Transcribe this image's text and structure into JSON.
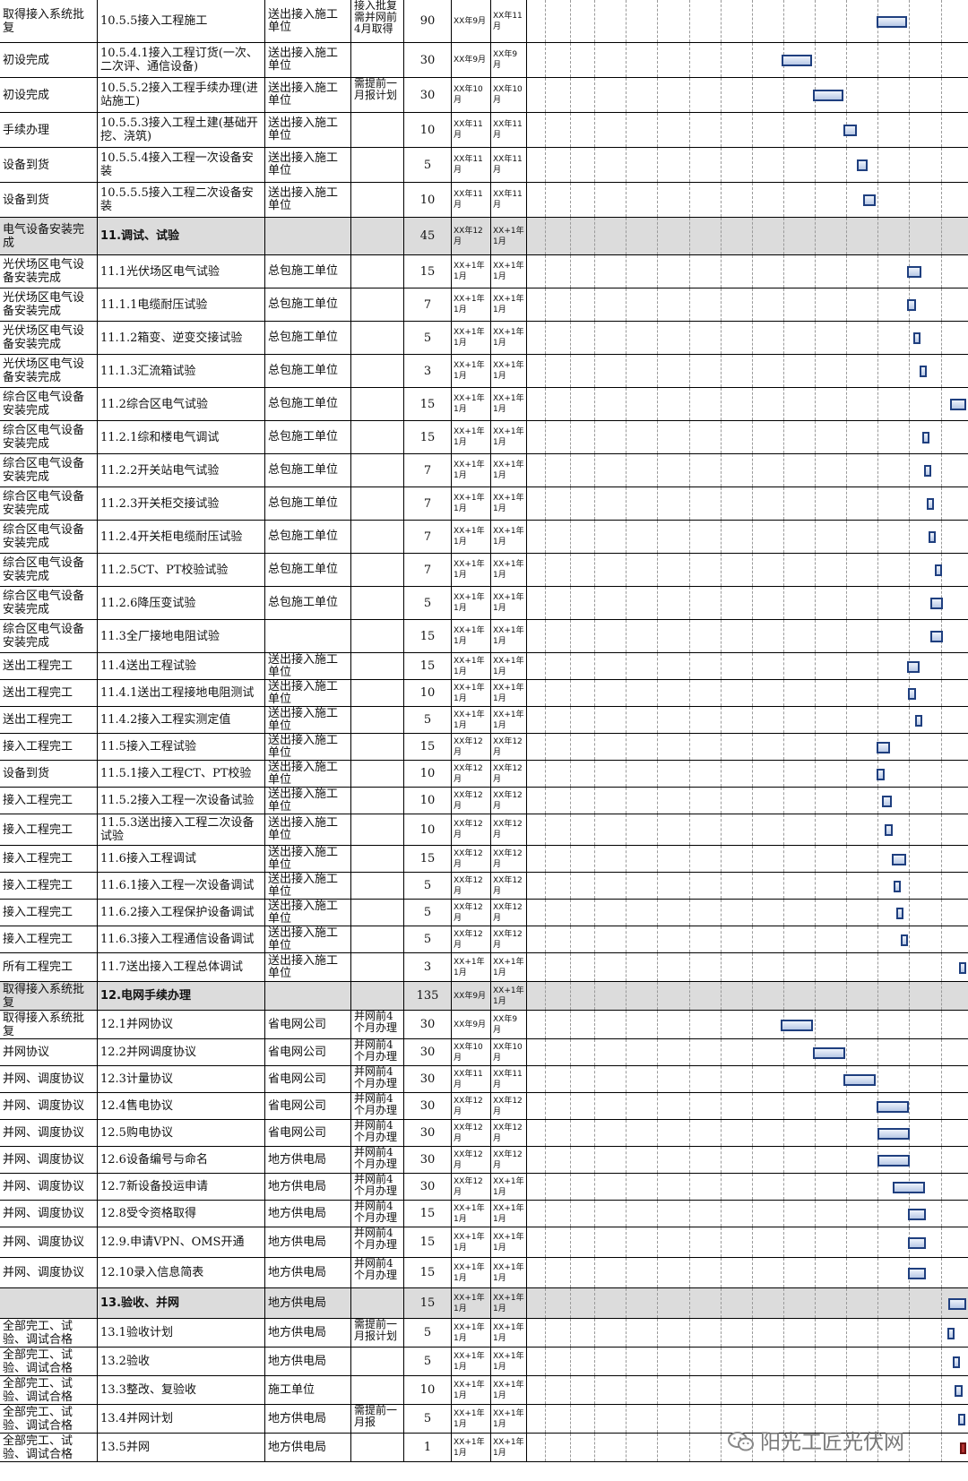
{
  "rows": [
    {
      "pre": "取得接入系统批复",
      "task": "10.5.5接入工程施工",
      "unit": "送出接入施工单位",
      "note": "接入批复需并网前4月取得",
      "dur": "90",
      "start": "XX年9月",
      "end": "XX年11月",
      "bar": {
        "s": 0.795,
        "w": 0.07
      }
    },
    {
      "pre": "初设完成",
      "task": "10.5.4.1接入工程订货(一次、二次评、通信设备)",
      "unit": "送出接入施工单位",
      "note": "",
      "dur": "30",
      "start": "XX年9月",
      "end": "XX年9月",
      "bar": {
        "s": 0.58,
        "w": 0.07
      }
    },
    {
      "pre": "初设完成",
      "task": "10.5.5.2接入工程手续办理(进站施工)",
      "unit": "送出接入施工单位",
      "note": "需提前一月报计划",
      "dur": "30",
      "start": "XX年10月",
      "end": "XX年10月",
      "bar": {
        "s": 0.65,
        "w": 0.07
      }
    },
    {
      "pre": "手续办理",
      "task": "10.5.5.3接入工程土建(基础开挖、浇筑)",
      "unit": "送出接入施工单位",
      "note": "",
      "dur": "10",
      "start": "XX年11月",
      "end": "XX年11月",
      "bar": {
        "s": 0.72,
        "w": 0.03
      }
    },
    {
      "pre": "设备到货",
      "task": "10.5.5.4接入工程一次设备安装",
      "unit": "送出接入施工单位",
      "note": "",
      "dur": "5",
      "start": "XX年11月",
      "end": "XX年11月",
      "bar": {
        "s": 0.75,
        "w": 0.024
      }
    },
    {
      "pre": "设备到货",
      "task": "10.5.5.5接入工程二次设备安装",
      "unit": "送出接入施工单位",
      "note": "",
      "dur": "10",
      "start": "XX年11月",
      "end": "XX年11月",
      "bar": {
        "s": 0.765,
        "w": 0.028
      }
    },
    {
      "hdr": true,
      "pre": "电气设备安装完成",
      "task": "11.调试、试验",
      "unit": "",
      "note": "",
      "dur": "45",
      "start": "XX年12月",
      "end": "XX+1年1月",
      "bar": null
    },
    {
      "pre": "光伏场区电气设备安装完成",
      "task": "11.1光伏场区电气试验",
      "unit": "总包施工单位",
      "note": "",
      "dur": "15",
      "start": "XX+1年1月",
      "end": "XX+1年1月",
      "bar": {
        "s": 0.866,
        "w": 0.032
      }
    },
    {
      "pre": "光伏场区电气设备安装完成",
      "task": "11.1.1电缆耐压试验",
      "unit": "总包施工单位",
      "note": "",
      "dur": "7",
      "start": "XX+1年1月",
      "end": "XX+1年1月",
      "bar": {
        "s": 0.866,
        "w": 0.02
      }
    },
    {
      "pre": "光伏场区电气设备安装完成",
      "task": "11.1.2箱变、逆变交接试验",
      "unit": "总包施工单位",
      "note": "",
      "dur": "5",
      "start": "XX+1年1月",
      "end": "XX+1年1月",
      "bar": {
        "s": 0.88,
        "w": 0.013
      }
    },
    {
      "pre": "光伏场区电气设备安装完成",
      "task": "11.1.3汇流箱试验",
      "unit": "总包施工单位",
      "note": "",
      "dur": "3",
      "start": "XX+1年1月",
      "end": "XX+1年1月",
      "bar": {
        "s": 0.893,
        "w": 0.012
      }
    },
    {
      "pre": "综合区电气设备安装完成",
      "task": "11.2综合区电气试验",
      "unit": "总包施工单位",
      "note": "",
      "dur": "15",
      "start": "XX+1年1月",
      "end": "XX+1年1月",
      "bar": {
        "s": 0.963,
        "w": 0.037
      }
    },
    {
      "pre": "综合区电气设备安装完成",
      "task": "11.2.1综和楼电气调试",
      "unit": "总包施工单位",
      "note": "",
      "dur": "15",
      "start": "XX+1年1月",
      "end": "XX+1年1月",
      "bar": {
        "s": 0.9,
        "w": 0.013
      }
    },
    {
      "pre": "综合区电气设备安装完成",
      "task": "11.2.2开关站电气试验",
      "unit": "总包施工单位",
      "note": "",
      "dur": "7",
      "start": "XX+1年1月",
      "end": "XX+1年1月",
      "bar": {
        "s": 0.904,
        "w": 0.013
      }
    },
    {
      "pre": "综合区电气设备安装完成",
      "task": "11.2.3开关柜交接试验",
      "unit": "总包施工单位",
      "note": "",
      "dur": "7",
      "start": "XX+1年1月",
      "end": "XX+1年1月",
      "bar": {
        "s": 0.91,
        "w": 0.012
      }
    },
    {
      "pre": "综合区电气设备安装完成",
      "task": "11.2.4开关柜电缆耐压试验",
      "unit": "总包施工单位",
      "note": "",
      "dur": "7",
      "start": "XX+1年1月",
      "end": "XX+1年1月",
      "bar": {
        "s": 0.915,
        "w": 0.012
      }
    },
    {
      "pre": "综合区电气设备安装完成",
      "task": "11.2.5CT、PT校验试验",
      "unit": "总包施工单位",
      "note": "",
      "dur": "7",
      "start": "XX+1年1月",
      "end": "XX+1年1月",
      "bar": {
        "s": 0.928,
        "w": 0.012
      }
    },
    {
      "pre": "综合区电气设备安装完成",
      "task": "11.2.6降压变试验",
      "unit": "总包施工单位",
      "note": "",
      "dur": "5",
      "start": "XX+1年1月",
      "end": "XX+1年1月",
      "bar": {
        "s": 0.918,
        "w": 0.028
      }
    },
    {
      "pre": "综合区电气设备安装完成",
      "task": "11.3全厂接地电阻试验",
      "unit": "",
      "note": "",
      "dur": "15",
      "start": "XX+1年1月",
      "end": "XX+1年1月",
      "bar": {
        "s": 0.918,
        "w": 0.028
      }
    },
    {
      "pre": "送出工程完工",
      "task": "11.4送出工程试验",
      "unit": "送出接入施工单位",
      "note": "",
      "dur": "15",
      "start": "XX+1年1月",
      "end": "XX+1年1月",
      "bar": {
        "s": 0.866,
        "w": 0.028
      }
    },
    {
      "pre": "送出工程完工",
      "task": "11.4.1送出工程接地电阻测试",
      "unit": "送出接入施工单位",
      "note": "",
      "dur": "10",
      "start": "XX+1年1月",
      "end": "XX+1年1月",
      "bar": {
        "s": 0.868,
        "w": 0.019
      }
    },
    {
      "pre": "送出工程完工",
      "task": "11.4.2接入工程实测定值",
      "unit": "送出接入施工单位",
      "note": "",
      "dur": "5",
      "start": "XX+1年1月",
      "end": "XX+1年1月",
      "bar": {
        "s": 0.883,
        "w": 0.012
      }
    },
    {
      "pre": "接入工程完工",
      "task": "11.5接入工程试验",
      "unit": "送出接入施工单位",
      "note": "",
      "dur": "15",
      "start": "XX年12月",
      "end": "XX年12月",
      "bar": {
        "s": 0.795,
        "w": 0.03
      }
    },
    {
      "pre": "设备到货",
      "task": "11.5.1接入工程CT、PT校验",
      "unit": "送出接入施工单位",
      "note": "",
      "dur": "10",
      "start": "XX年12月",
      "end": "XX年12月",
      "bar": {
        "s": 0.795,
        "w": 0.018
      }
    },
    {
      "pre": "接入工程完工",
      "task": "11.5.2接入工程一次设备试验",
      "unit": "送出接入施工单位",
      "note": "",
      "dur": "10",
      "start": "XX年12月",
      "end": "XX年12月",
      "bar": {
        "s": 0.808,
        "w": 0.022
      }
    },
    {
      "pre": "接入工程完工",
      "task": "11.5.3送出接入工程二次设备试验",
      "unit": "送出接入施工单位",
      "note": "",
      "dur": "10",
      "start": "XX年12月",
      "end": "XX年12月",
      "bar": {
        "s": 0.815,
        "w": 0.019
      }
    },
    {
      "pre": "接入工程完工",
      "task": "11.6接入工程调试",
      "unit": "送出接入施工单位",
      "note": "",
      "dur": "15",
      "start": "XX年12月",
      "end": "XX年12月",
      "bar": {
        "s": 0.83,
        "w": 0.032
      }
    },
    {
      "pre": "接入工程完工",
      "task": "11.6.1接入工程一次设备调试",
      "unit": "送出接入施工单位",
      "note": "",
      "dur": "5",
      "start": "XX年12月",
      "end": "XX年12月",
      "bar": {
        "s": 0.834,
        "w": 0.015
      }
    },
    {
      "pre": "接入工程完工",
      "task": "11.6.2接入工程保护设备调试",
      "unit": "送出接入施工单位",
      "note": "",
      "dur": "5",
      "start": "XX年12月",
      "end": "XX年12月",
      "bar": {
        "s": 0.84,
        "w": 0.015
      }
    },
    {
      "pre": "接入工程完工",
      "task": "11.6.3接入工程通信设备调试",
      "unit": "送出接入施工单位",
      "note": "",
      "dur": "5",
      "start": "XX年12月",
      "end": "XX年12月",
      "bar": {
        "s": 0.85,
        "w": 0.011
      }
    },
    {
      "pre": "所有工程完工",
      "task": "11.7送出接入工程总体调试",
      "unit": "送出接入施工单位",
      "note": "",
      "dur": "3",
      "start": "XX+1年1月",
      "end": "XX+1年1月",
      "bar": {
        "s": 0.984,
        "w": 0.014
      }
    },
    {
      "hdr": true,
      "pre": "取得接入系统批复",
      "task": "12.电网手续办理",
      "unit": "",
      "note": "",
      "dur": "135",
      "start": "XX年9月",
      "end": "XX+1年1月",
      "bar": null
    },
    {
      "pre": "取得接入系统批复",
      "task": "12.1并网协议",
      "unit": "省电网公司",
      "note": "并网前4个月办理",
      "dur": "30",
      "start": "XX年9月",
      "end": "XX年9月",
      "bar": {
        "s": 0.578,
        "w": 0.074
      }
    },
    {
      "pre": "并网协议",
      "task": "12.2并网调度协议",
      "unit": "省电网公司",
      "note": "并网前4个月办理",
      "dur": "30",
      "start": "XX年10月",
      "end": "XX年10月",
      "bar": {
        "s": 0.65,
        "w": 0.074
      }
    },
    {
      "pre": "并网、调度协议",
      "task": "12.3计量协议",
      "unit": "省电网公司",
      "note": "并网前4个月办理",
      "dur": "30",
      "start": "XX年11月",
      "end": "XX年11月",
      "bar": {
        "s": 0.72,
        "w": 0.074
      }
    },
    {
      "pre": "并网、调度协议",
      "task": "12.4售电协议",
      "unit": "省电网公司",
      "note": "并网前4个月办理",
      "dur": "30",
      "start": "XX年12月",
      "end": "XX年12月",
      "bar": {
        "s": 0.795,
        "w": 0.074
      }
    },
    {
      "pre": "并网、调度协议",
      "task": "12.5购电协议",
      "unit": "省电网公司",
      "note": "并网前4个月办理",
      "dur": "30",
      "start": "XX年12月",
      "end": "XX年12月",
      "bar": {
        "s": 0.797,
        "w": 0.074
      }
    },
    {
      "pre": "并网、调度协议",
      "task": "12.6设备编号与命名",
      "unit": "地方供电局",
      "note": "并网前4个月办理",
      "dur": "30",
      "start": "XX年12月",
      "end": "XX年12月",
      "bar": {
        "s": 0.797,
        "w": 0.074
      }
    },
    {
      "pre": "并网、调度协议",
      "task": "12.7新设备投运申请",
      "unit": "地方供电局",
      "note": "并网前4个月办理",
      "dur": "30",
      "start": "XX年12月",
      "end": "XX+1年1月",
      "bar": {
        "s": 0.833,
        "w": 0.074
      }
    },
    {
      "pre": "并网、调度协议",
      "task": "12.8受令资格取得",
      "unit": "地方供电局",
      "note": "并网前4个月办理",
      "dur": "15",
      "start": "XX+1年1月",
      "end": "XX+1年1月",
      "bar": {
        "s": 0.868,
        "w": 0.04
      }
    },
    {
      "pre": "并网、调度协议",
      "task": "12.9.申请VPN、OMS开通",
      "unit": "地方供电局",
      "note": "并网前4个月办理",
      "dur": "15",
      "start": "XX+1年1月",
      "end": "XX+1年1月",
      "bar": {
        "s": 0.868,
        "w": 0.04
      }
    },
    {
      "pre": "并网、调度协议",
      "task": "12.10录入信息简表",
      "unit": "地方供电局",
      "note": "并网前4个月办理",
      "dur": "15",
      "start": "XX+1年1月",
      "end": "XX+1年1月",
      "bar": {
        "s": 0.868,
        "w": 0.04
      }
    },
    {
      "hdr": true,
      "pre": "",
      "task": "13.验收、并网",
      "unit": "地方供电局",
      "note": "",
      "dur": "15",
      "start": "XX+1年1月",
      "end": "XX+1年1月",
      "bar": {
        "s": 0.96,
        "w": 0.04
      }
    },
    {
      "pre": "全部完工、试验、调试合格",
      "task": "13.1验收计划",
      "unit": "地方供电局",
      "note": "需提前一月报计划",
      "dur": "5",
      "start": "XX+1年1月",
      "end": "XX+1年1月",
      "bar": {
        "s": 0.958,
        "w": 0.015
      }
    },
    {
      "pre": "全部完工、试验、调试合格",
      "task": "13.2验收",
      "unit": "地方供电局",
      "note": "",
      "dur": "5",
      "start": "XX+1年1月",
      "end": "XX+1年1月",
      "bar": {
        "s": 0.97,
        "w": 0.013
      }
    },
    {
      "pre": "全部完工、试验、调试合格",
      "task": "13.3整改、复验收",
      "unit": "施工单位",
      "note": "",
      "dur": "10",
      "start": "XX+1年1月",
      "end": "XX+1年1月",
      "bar": {
        "s": 0.974,
        "w": 0.018
      }
    },
    {
      "pre": "全部完工、试验、调试合格",
      "task": "13.4并网计划",
      "unit": "地方供电局",
      "note": "需提前一月报",
      "dur": "5",
      "start": "XX+1年1月",
      "end": "XX+1年1月",
      "bar": {
        "s": 0.982,
        "w": 0.013
      }
    },
    {
      "pre": "全部完工、试验、调试合格",
      "task": "13.5并网",
      "unit": "地方供电局",
      "note": "",
      "dur": "1",
      "start": "XX+1年1月",
      "end": "XX+1年1月",
      "bar": {
        "s": 0.985,
        "w": 0.012,
        "red": true
      }
    }
  ],
  "watermark": {
    "text": "阳光工匠光伏网",
    "icon": "wechat-icon"
  },
  "colors": {
    "bar_border": "#1f3f7f",
    "bar_fill": "#b8c9e6",
    "header_row": "#dcdcdc",
    "milestone": "#b23030"
  }
}
